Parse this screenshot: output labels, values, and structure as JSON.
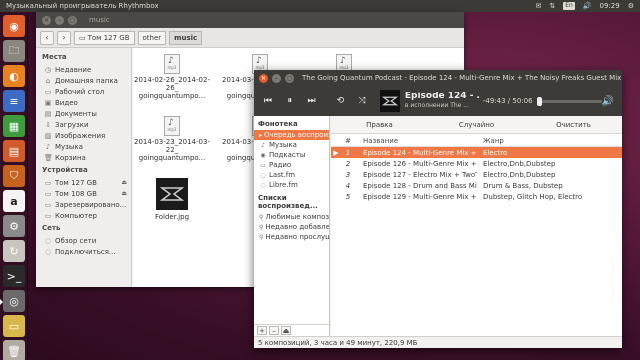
{
  "top_panel": {
    "app_title": "Музыкальный проигрыватель Rhythmbox",
    "kbd_layout": "En",
    "clock": "09:29"
  },
  "launcher": {
    "items": [
      "ubuntu-icon",
      "files-icon",
      "firefox-icon",
      "writer-icon",
      "calc-icon",
      "impress-icon",
      "software-center-icon",
      "amazon-icon",
      "settings-icon",
      "terminal-icon",
      "rhythmbox-icon"
    ]
  },
  "file_manager": {
    "title": "music",
    "breadcrumbs": [
      "Том 127 GB",
      "other",
      "music"
    ],
    "sections": {
      "places": "Места",
      "devices": "Устройства",
      "network": "Сеть"
    },
    "places": [
      "Недавние",
      "Домашняя папка",
      "Рабочий стол",
      "Видео",
      "Документы",
      "Загрузки",
      "Изображения",
      "Музыка",
      "Корзина"
    ],
    "devices": [
      "Том 127 GB",
      "Том 108 GB",
      "Зарезервировано...",
      "Компьютер"
    ],
    "network": [
      "Обзор сети",
      "Подключиться..."
    ],
    "files": [
      {
        "name": "2014-02-26_2014-02-26_goingquantumpo...",
        "line1": "2014-02-26_2014-02-",
        "line2": "26_",
        "line3": "goingquantumpo..."
      },
      {
        "name": "2014-03-03_2014-03-03_goingquantumpo...",
        "line1": "2014-03-03_2014-03-",
        "line2": "03_",
        "line3": "goingquantumpo..."
      },
      {
        "name": "2014-03-23_2014-03-22_goingquantumpo...",
        "line1": "2014-03-23_2014-03-",
        "line2": "22_",
        "line3": "goingquantumpo..."
      },
      {
        "name": "2014-03-30_2014-03-29_goingquantumpo...",
        "line1": "2014-03-30_2014-03-",
        "line2": "29_",
        "line3": "goingquantumpo..."
      }
    ],
    "folder_jpg": "Folder.jpg",
    "mp3_tag": "mp3"
  },
  "rhythmbox": {
    "title": "The Going Quantum Podcast - Episode 124 - Multi-Genre Mix + The Noisy Freaks Guest Mix",
    "now_playing_title": "Episode 124 - ...",
    "now_playing_artist": "в исполнении The ...",
    "time": "-49:43 / 50:06",
    "progress": 0.01,
    "library_head": "Фонотека",
    "library": [
      "Очередь воспроизв...",
      "Музыка",
      "Подкасты",
      "Радио",
      "Last.fm",
      "Libre.fm"
    ],
    "playlists_head": "Списки воспроизвед...",
    "playlists": [
      "Любимые композ...",
      "Недавно добавле...",
      "Недавно прослуш..."
    ],
    "toolbar": {
      "edit": "Правка",
      "shuffle": "Случайно",
      "clear": "Очистить"
    },
    "columns": {
      "num": "#",
      "name": "Название",
      "genre": "Жанр"
    },
    "tracks": [
      {
        "n": "1",
        "name": "Episode 124 - Multi-Genre Mix + The...",
        "genre": "Electro"
      },
      {
        "n": "2",
        "name": "Episode 126 - Multi-Genre Mix + Ha...",
        "genre": "Electro,Dnb,Dubstep"
      },
      {
        "n": "3",
        "name": "Episode 127 - Electro Mix + TwoThir...",
        "genre": "Electro,Dnb,Dubstep"
      },
      {
        "n": "4",
        "name": "Episode 128 - Drum and Bass Mix + ...",
        "genre": "Drum & Bass, Dubstep"
      },
      {
        "n": "5",
        "name": "Episode 129 - Multi-Genre Mix + Flu...",
        "genre": "Dubstep, Glitch Hop, Electro"
      }
    ],
    "status": "5 композиций, 3 часа и 49 минут, 220,9 МБ"
  },
  "colors": {
    "accent": "#f07746",
    "panel": "#3b3a36",
    "close": "#e05e2b"
  }
}
